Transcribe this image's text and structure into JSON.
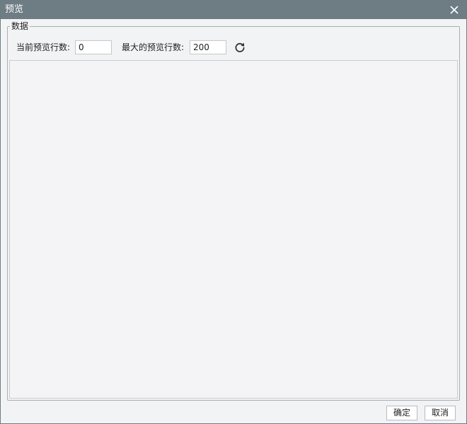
{
  "window": {
    "title": "预览",
    "close_icon": "close-icon"
  },
  "data_group": {
    "legend": "数据",
    "current_rows_label": "当前预览行数:",
    "current_rows_value": "0",
    "max_rows_label": "最大的预览行数:",
    "max_rows_value": "200",
    "refresh_icon": "refresh-icon"
  },
  "footer": {
    "ok_label": "确定",
    "cancel_label": "取消"
  },
  "colors": {
    "titlebar": "#6e7c84",
    "background": "#f2f3f5"
  }
}
